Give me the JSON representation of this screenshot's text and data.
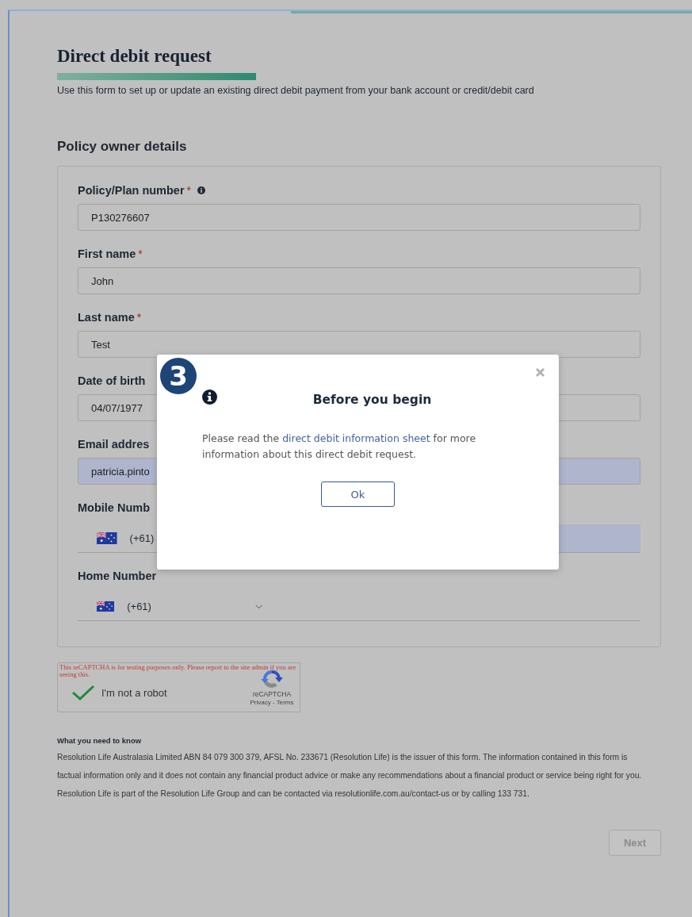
{
  "page": {
    "title": "Direct debit request",
    "intro": "Use this form to set up or update an existing direct debit payment from your bank account or credit/debit card"
  },
  "section": {
    "title": "Policy owner details",
    "fields": [
      {
        "kind": "text",
        "label": "Policy/Plan number",
        "required_mark": "*",
        "info": true,
        "value": "P130276607",
        "autofilled": false
      },
      {
        "kind": "text",
        "label": "First name",
        "required_mark": "*",
        "info": false,
        "value": "John",
        "autofilled": false
      },
      {
        "kind": "text",
        "label": "Last name",
        "required_mark": "*",
        "info": false,
        "value": "Test",
        "autofilled": false
      },
      {
        "kind": "text",
        "label": "Date of birth",
        "info": false,
        "value": "04/07/1977",
        "autofilled": false
      },
      {
        "kind": "text",
        "label": "Email addres",
        "info": false,
        "value": "patricia.pinto",
        "autofilled": true
      },
      {
        "kind": "phone",
        "label": "Mobile Numb",
        "info": false,
        "value": "(+61)",
        "autofilled": true
      },
      {
        "kind": "phone",
        "label": "Home Number",
        "info": false,
        "value": "(+61)",
        "autofilled": false,
        "chevron": true
      }
    ]
  },
  "captcha": {
    "notice": "This reCAPTCHA is for testing purposes only. Please report to the site admin if you are seeing this.",
    "label": "I'm not a robot",
    "checked": true,
    "brand": "reCAPTCHA",
    "links": "Privacy - Terms"
  },
  "footer": {
    "title": "What you need to know",
    "paragraphs": [
      "Resolution Life Australasia Limited ABN 84 079 300 379, AFSL No. 233671 (Resolution Life) is the issuer of this form. The information contained in this form is factual information only and it does not contain any financial product advice or make any recommendations about a financial product or service being right for you.",
      "Resolution Life is part of the Resolution Life Group and can be contacted via resolutionlife.com.au/contact-us or by calling 133 731."
    ]
  },
  "next_button": {
    "label": "Next",
    "disabled": true
  },
  "modal": {
    "step": "3",
    "title": "Before you begin",
    "text_before": "Please read the ",
    "link": "direct debit information sheet",
    "text_after": " for more information about this direct debit request.",
    "ok": "Ok"
  }
}
